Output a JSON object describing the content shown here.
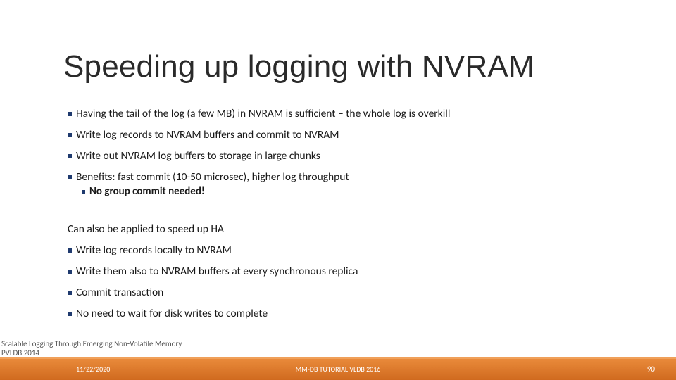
{
  "title": "Speeding up logging with NVRAM",
  "bullets_top": [
    "Having the tail of the log (a few MB) in NVRAM is sufficient – the whole log is overkill",
    "Write log records to NVRAM buffers and commit to NVRAM",
    "Write out NVRAM log buffers to storage in large chunks",
    "Benefits: fast commit (10-50 microsec), higher log throughput"
  ],
  "sub_bullet": "No group commit needed!",
  "section_intro": "Can also be applied to speed up HA",
  "bullets_bottom": [
    "Write log records locally to NVRAM",
    "Write them also to NVRAM buffers at every synchronous replica",
    "Commit transaction",
    "No need to wait for disk writes to complete"
  ],
  "citation_line1": "Scalable Logging Through Emerging Non-Volatile Memory",
  "citation_line2": "PVLDB 2014",
  "footer": {
    "date": "11/22/2020",
    "center": "MM-DB TUTORIAL VLDB 2016",
    "pageno": "90"
  }
}
